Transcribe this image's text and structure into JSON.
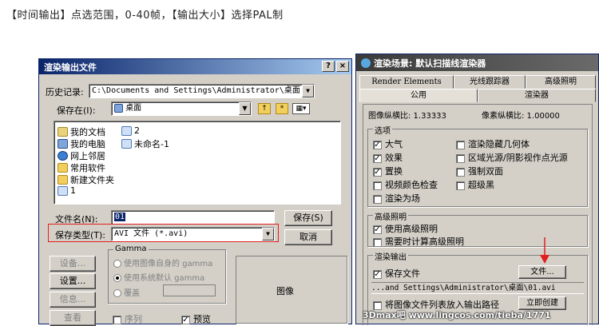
{
  "caption": "【时间输出】点选范围，0-40帧，【输出大小】选择PAL制",
  "file_dialog": {
    "title": "渲染输出文件",
    "help_btn": "?",
    "close_btn": "×",
    "history_label": "历史记录:",
    "history_value": "C:\\Documents and Settings\\Administrator\\桌面",
    "save_in_label": "保存在(I):",
    "save_in_value": "桌面",
    "files": [
      {
        "name": "我的文档",
        "icon": "documents-icon"
      },
      {
        "name": "我的电脑",
        "icon": "computer-icon"
      },
      {
        "name": "网上邻居",
        "icon": "network-icon"
      },
      {
        "name": "常用软件",
        "icon": "folder-icon"
      },
      {
        "name": "新建文件夹",
        "icon": "folder-icon"
      },
      {
        "name": "1",
        "icon": "avi-file-icon"
      },
      {
        "name": "2",
        "icon": "avi-file-icon"
      },
      {
        "name": "未命名-1",
        "icon": "avi-file-icon"
      }
    ],
    "filename_label": "文件名(N):",
    "filename_value": "01",
    "filetype_label": "保存类型(T):",
    "filetype_value": "AVI 文件 (*.avi)",
    "save_btn": "保存(S)",
    "cancel_btn": "取消",
    "devices_btn": "设备...",
    "setup_btn": "设置...",
    "info_btn": "信息...",
    "view_btn": "查看",
    "gamma_title": "Gamma",
    "gamma_opt1": "使用图像自身的 gamma",
    "gamma_opt2": "使用系统默认 gamma",
    "gamma_opt3": "覆盖",
    "sequence_label": "序列",
    "preview_label": "预览",
    "image_label": "图像"
  },
  "render_dialog": {
    "title": "渲染场景: 默认扫描线渲染器",
    "tabs_row1": [
      "Render Elements",
      "光线跟踪器",
      "高级照明"
    ],
    "tabs_row2": [
      "公用",
      "渲染器"
    ],
    "aspect_label": "图像纵横比: 1.33333",
    "pixel_aspect_label": "像素纵横比: 1.00000",
    "options_title": "选项",
    "options": [
      {
        "label": "大气",
        "checked": true
      },
      {
        "label": "渲染隐藏几何体",
        "checked": false
      },
      {
        "label": "效果",
        "checked": true
      },
      {
        "label": "区域光源/阴影视作点光源",
        "checked": false
      },
      {
        "label": "置换",
        "checked": true
      },
      {
        "label": "强制双面",
        "checked": false
      },
      {
        "label": "视频颜色检查",
        "checked": false
      },
      {
        "label": "超级黑",
        "checked": false
      },
      {
        "label": "渲染为场",
        "checked": false
      }
    ],
    "adv_title": "高级照明",
    "adv_opt1": "使用高级照明",
    "adv_opt2": "需要时计算高级照明",
    "output_title": "渲染输出",
    "save_file_label": "保存文件",
    "files_btn": "文件...",
    "output_path": "...and Settings\\Administrator\\桌面\\01.avi",
    "put_list_label": "将图像文件列表放入输出路径",
    "create_now_btn": "立即创建"
  },
  "watermark": "3Dmax吧 www.lingcos.com/tieba/1771",
  "check_mark": "✓",
  "colors": {
    "accent_red": "#e02020",
    "title_blue": "#0a246a"
  }
}
